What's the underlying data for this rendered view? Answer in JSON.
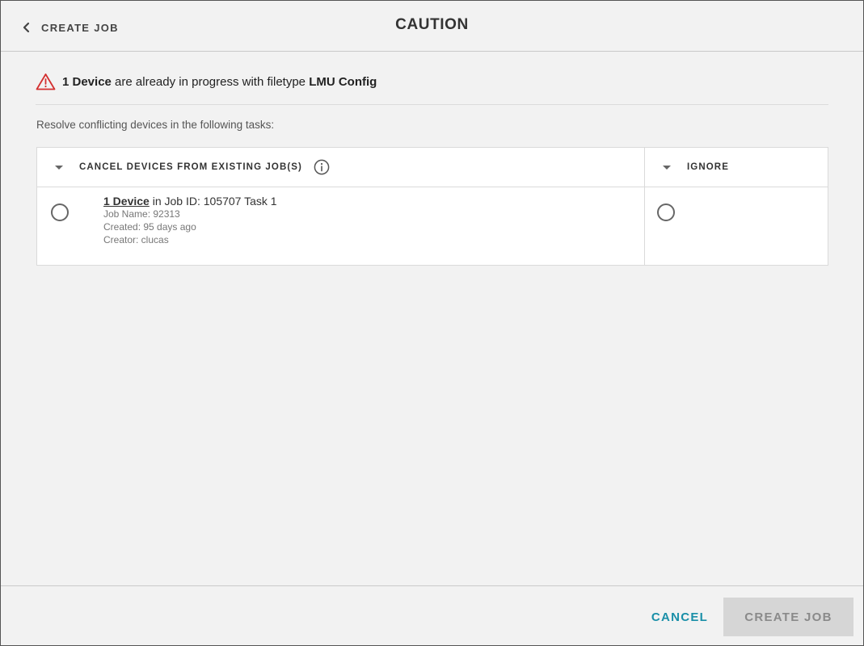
{
  "header": {
    "back_label": "CREATE JOB",
    "title": "CAUTION"
  },
  "warning": {
    "count": "1 Device",
    "middle": " are already in progress with filetype ",
    "filetype": "LMU Config"
  },
  "instructions": "Resolve conflicting devices in the following tasks:",
  "table": {
    "col_cancel": "CANCEL DEVICES FROM EXISTING JOB(S)",
    "col_ignore": "IGNORE",
    "row": {
      "device_link": "1 Device",
      "job_text": " in Job ID: 105707 Task 1",
      "job_name": "Job Name: 92313",
      "created": "Created: 95 days ago",
      "creator": "Creator: clucas"
    }
  },
  "footer": {
    "cancel_label": "CANCEL",
    "create_label": "CREATE JOB"
  },
  "colors": {
    "accent": "#1a8fa8",
    "warning": "#d32f2f",
    "disabled_bg": "#d6d6d6"
  }
}
